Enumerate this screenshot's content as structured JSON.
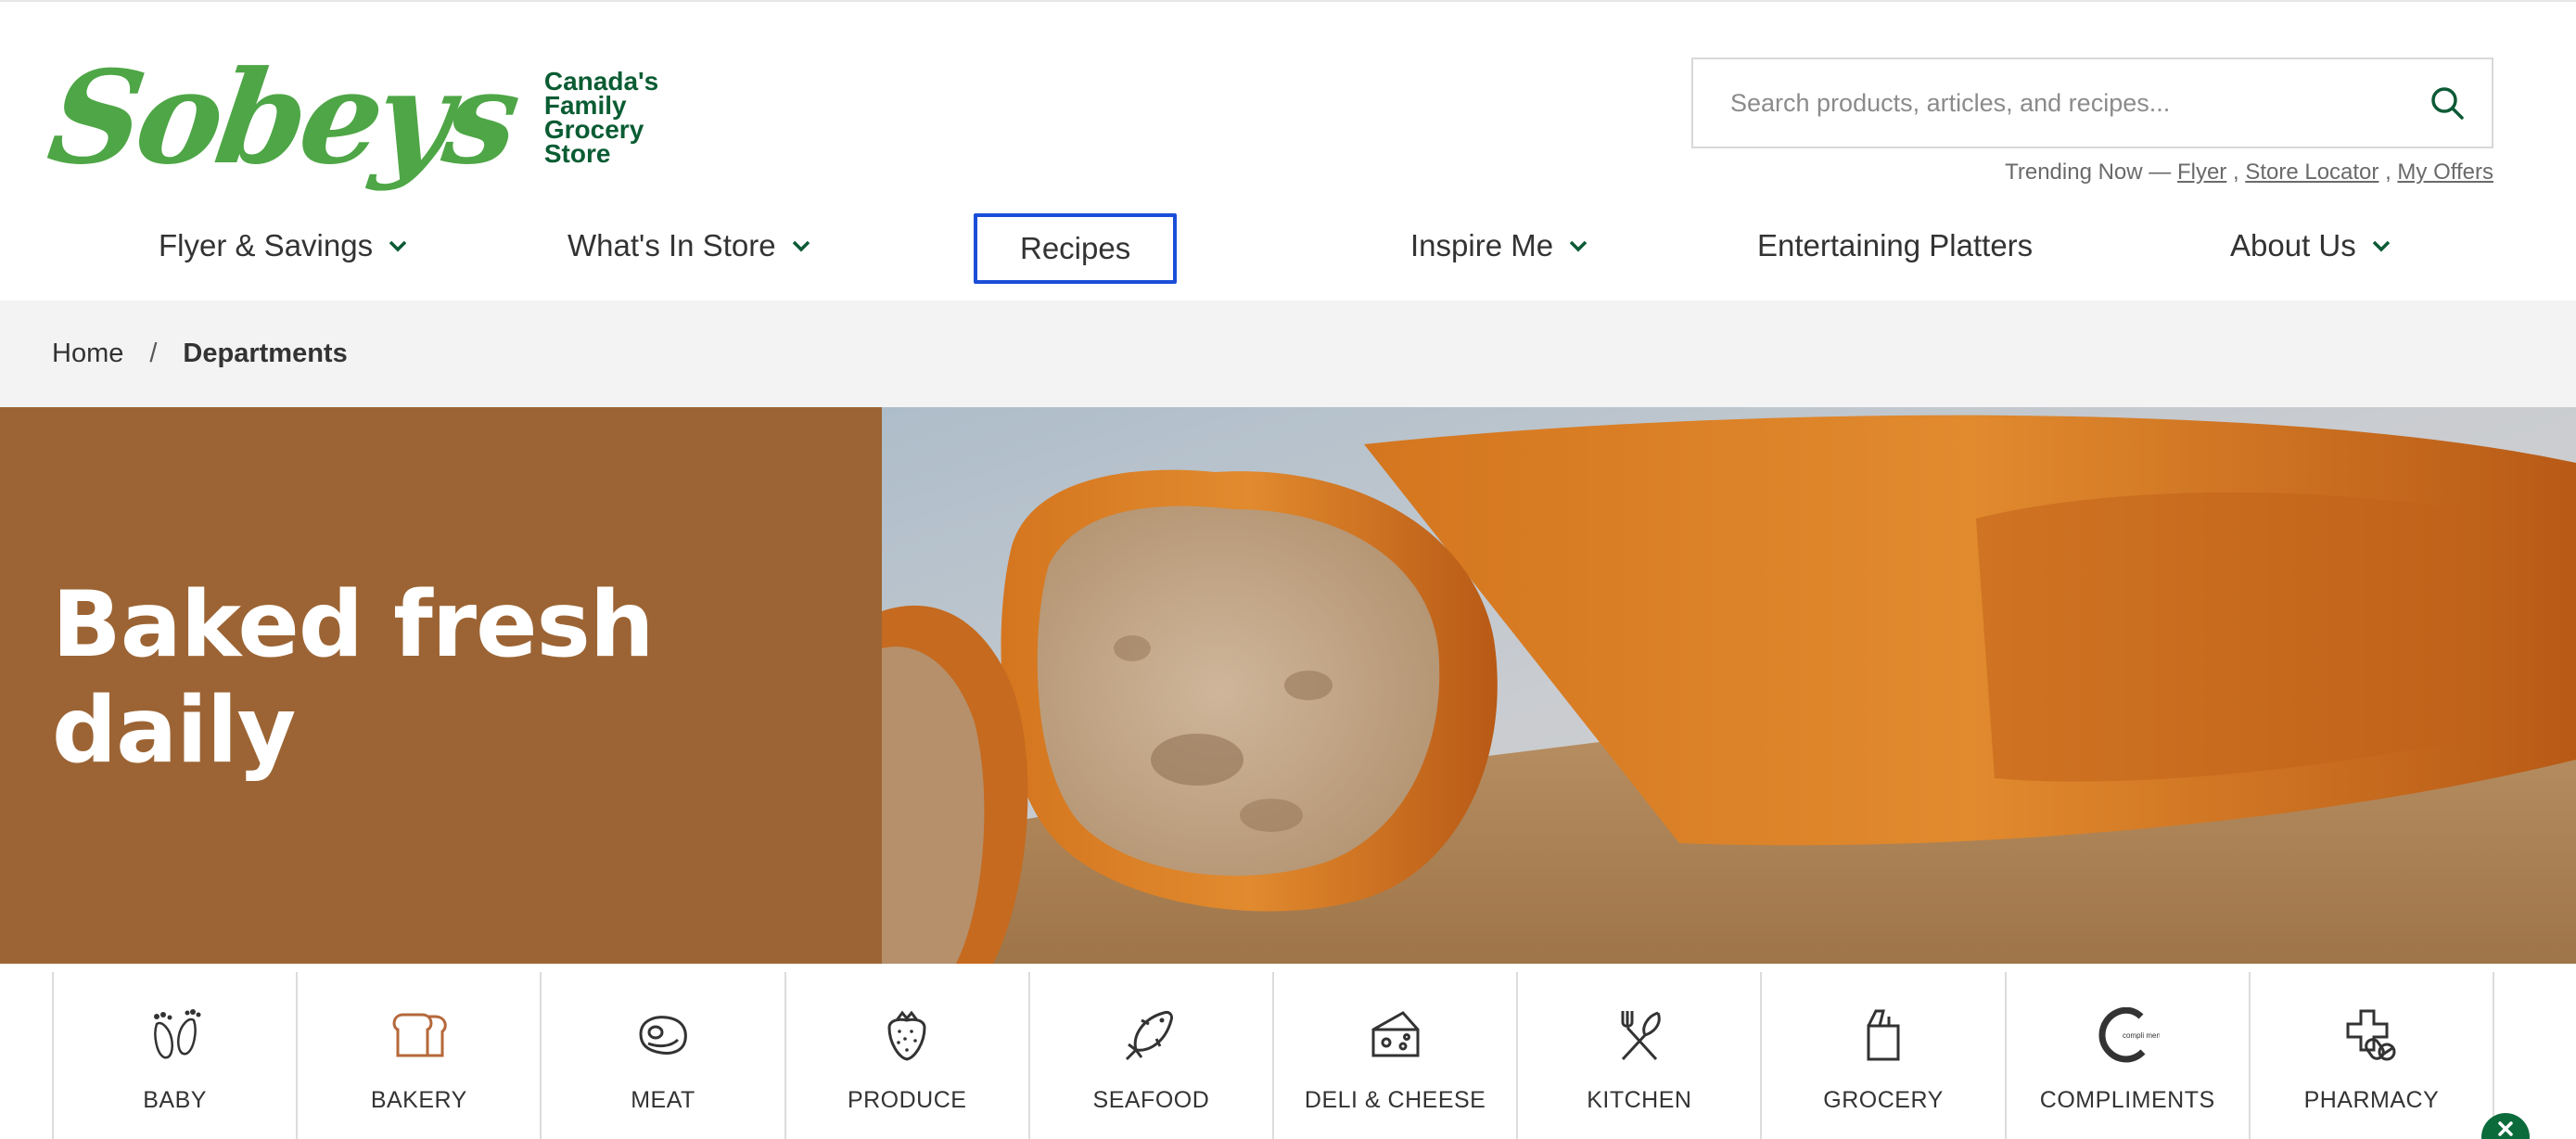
{
  "logo": {
    "word": "Sobeys",
    "tagline": "Canada's Family Grocery Store",
    "color": "#4ea646"
  },
  "search": {
    "placeholder": "Search products, articles, and recipes...",
    "icon": "search-icon"
  },
  "trending": {
    "label": "Trending Now —",
    "links": [
      "Flyer",
      "Store Locator",
      "My Offers"
    ]
  },
  "nav": {
    "items": [
      {
        "label": "Flyer & Savings",
        "has_dropdown": true
      },
      {
        "label": "What's In Store",
        "has_dropdown": true
      },
      {
        "label": "Recipes",
        "has_dropdown": false,
        "focused": true
      },
      {
        "label": "Inspire Me",
        "has_dropdown": true
      },
      {
        "label": "Entertaining Platters",
        "has_dropdown": false
      },
      {
        "label": "About Us",
        "has_dropdown": true
      }
    ]
  },
  "breadcrumb": {
    "home": "Home",
    "separator": "/",
    "current": "Departments"
  },
  "hero": {
    "title": "Baked fresh daily",
    "panel_color": "#9c6434"
  },
  "departments": [
    {
      "label": "BABY",
      "icon": "baby-feet-icon"
    },
    {
      "label": "BAKERY",
      "icon": "bread-icon"
    },
    {
      "label": "MEAT",
      "icon": "steak-icon"
    },
    {
      "label": "PRODUCE",
      "icon": "strawberry-icon"
    },
    {
      "label": "SEAFOOD",
      "icon": "fish-icon"
    },
    {
      "label": "DELI & CHEESE",
      "icon": "cheese-icon"
    },
    {
      "label": "KITCHEN",
      "icon": "utensils-icon"
    },
    {
      "label": "GROCERY",
      "icon": "grocery-bag-icon"
    },
    {
      "label": "COMPLIMENTS",
      "icon": "compliments-logo-icon"
    },
    {
      "label": "PHARMACY",
      "icon": "pharmacy-icon"
    }
  ],
  "compliments_logo_text": "compli ments",
  "colors": {
    "brand_green": "#4ea646",
    "dark_green": "#0a5c33",
    "focus_blue": "#1a4ed8",
    "bakery_icon": "#b5683a"
  }
}
